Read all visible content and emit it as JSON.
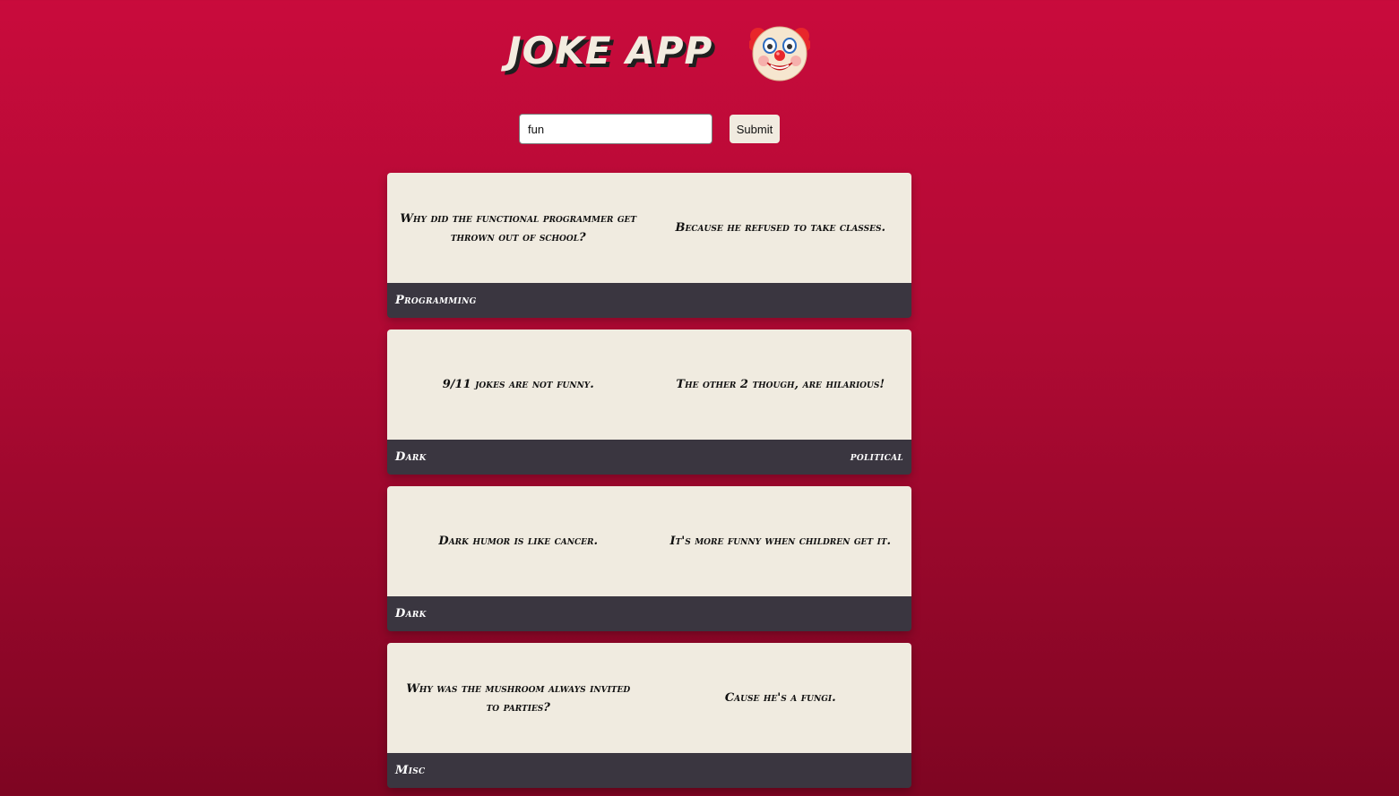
{
  "header": {
    "title": "JOKE APP",
    "emoji_icon": "clown-face-icon"
  },
  "search": {
    "value": "fun",
    "submit_label": "Submit"
  },
  "jokes": [
    {
      "setup": "Why did the functional programmer get thrown out of school?",
      "delivery": "Because he refused to take classes.",
      "category": "Programming",
      "flag": ""
    },
    {
      "setup": "9/11 jokes are not funny.",
      "delivery": "The other 2 though, are hilarious!",
      "category": "Dark",
      "flag": "political"
    },
    {
      "setup": "Dark humor is like cancer.",
      "delivery": "It's more funny when children get it.",
      "category": "Dark",
      "flag": ""
    },
    {
      "setup": "Why was the mushroom always invited to parties?",
      "delivery": "Cause he's a fungi.",
      "category": "Misc",
      "flag": ""
    }
  ],
  "colors": {
    "background_top": "#c90b3c",
    "background_bottom": "#7e0522",
    "card_body": "#f0ebe0",
    "card_footer": "#3a3640"
  }
}
